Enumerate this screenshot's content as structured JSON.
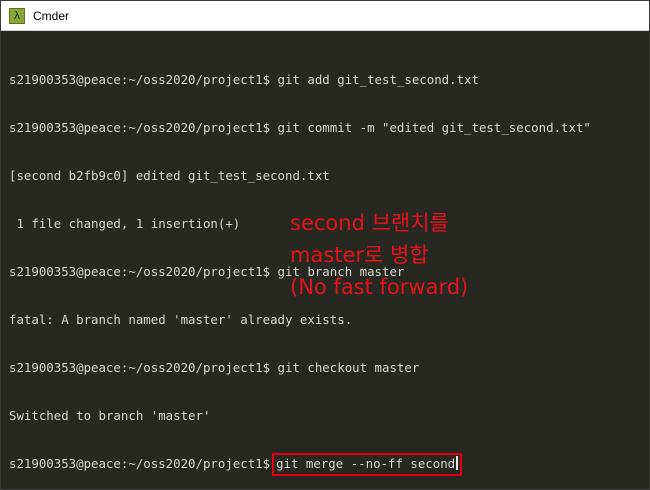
{
  "window": {
    "title": "Cmder",
    "app_icon_glyph": "λ",
    "app_icon_name": "lambda-icon"
  },
  "terminal": {
    "lines": [
      "s21900353@peace:~/oss2020/project1$ git add git_test_second.txt",
      "s21900353@peace:~/oss2020/project1$ git commit -m \"edited git_test_second.txt\"",
      "[second b2fb9c0] edited git_test_second.txt",
      " 1 file changed, 1 insertion(+)",
      "s21900353@peace:~/oss2020/project1$ git branch master",
      "fatal: A branch named 'master' already exists.",
      "s21900353@peace:~/oss2020/project1$ git checkout master",
      "Switched to branch 'master'"
    ],
    "current_prompt": "s21900353@peace:~/oss2020/project1$",
    "current_command": "git merge --no-ff second"
  },
  "annotation": {
    "lines": [
      "second 브랜치를",
      "master로 병합",
      "(No fast forward)"
    ]
  },
  "colors": {
    "terminal_bg": "#272822",
    "terminal_fg": "#d8d8d2",
    "highlight": "#e0000f",
    "annotation": "#e8121a"
  }
}
